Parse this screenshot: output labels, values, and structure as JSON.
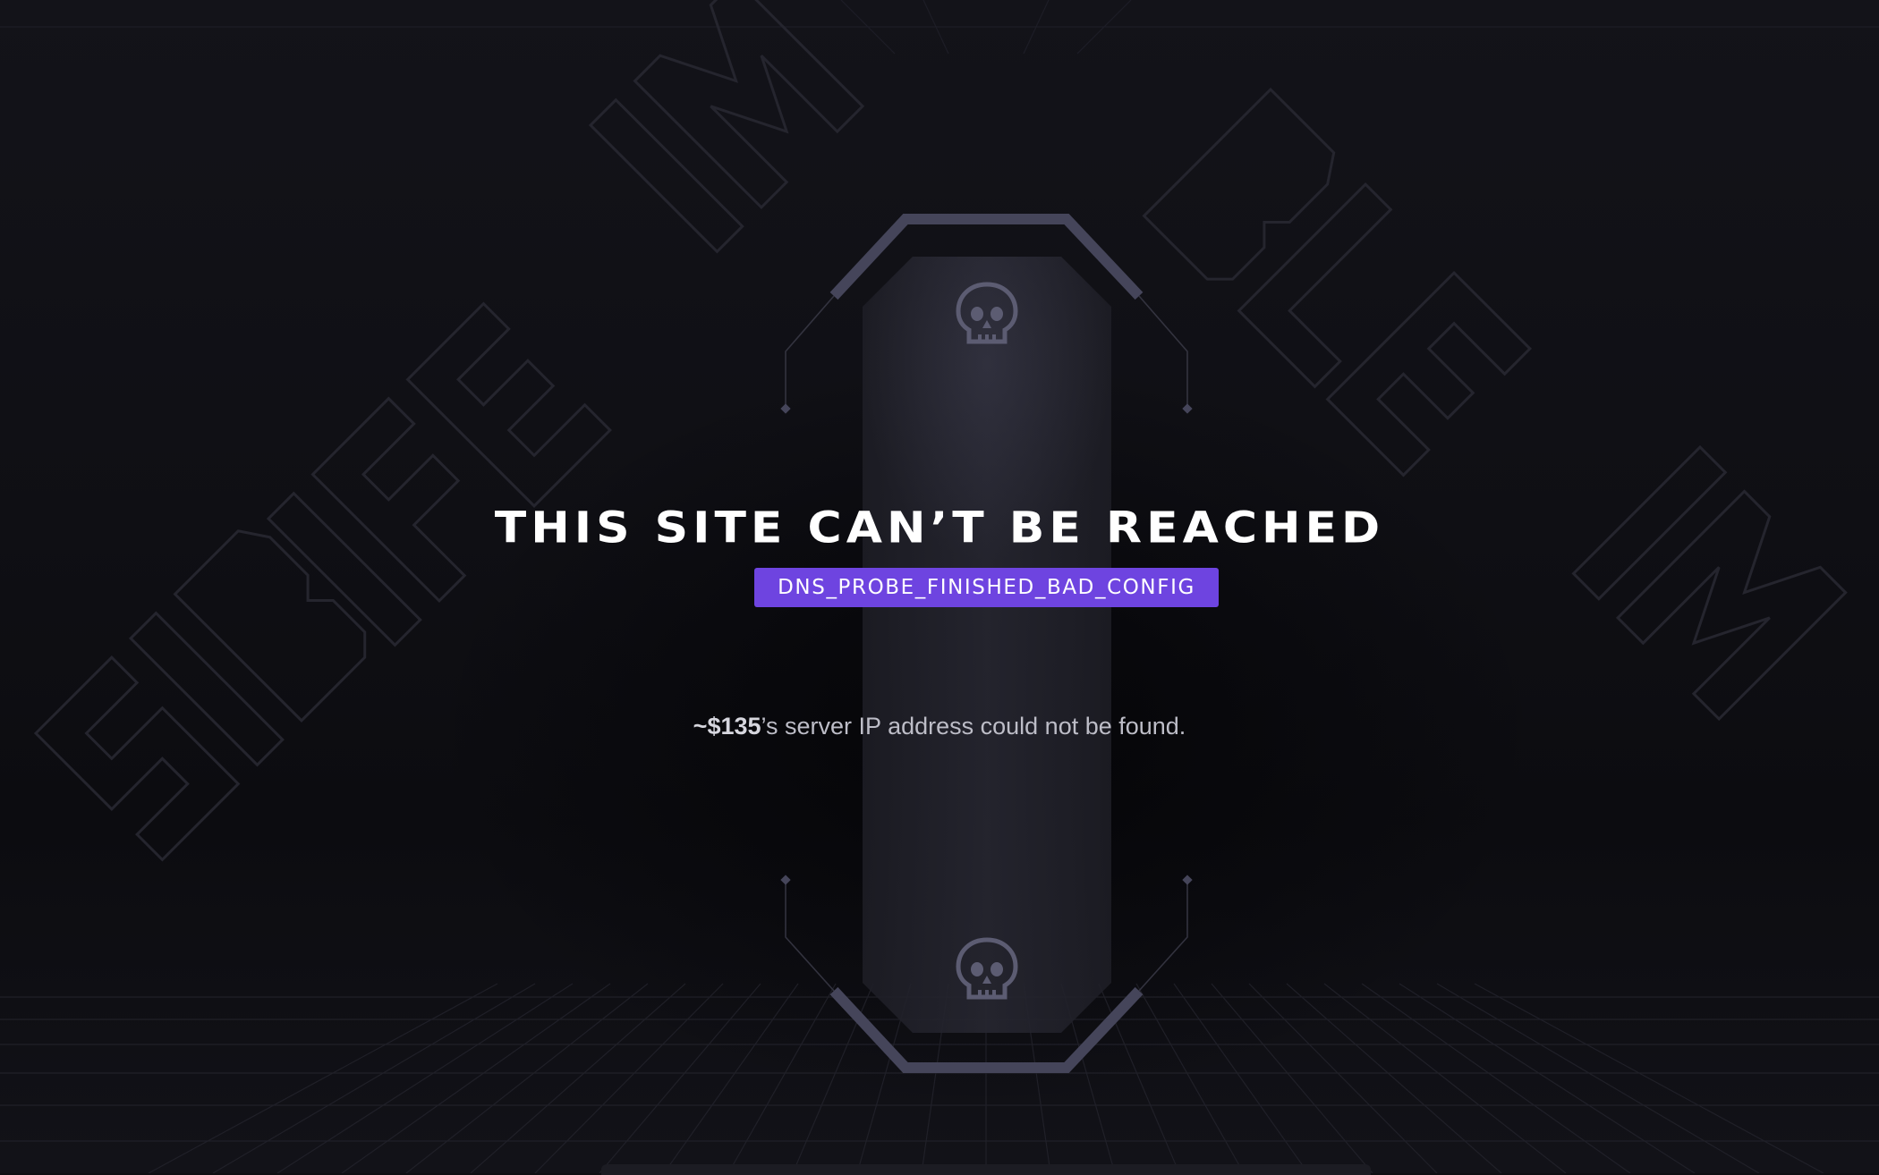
{
  "page": {
    "title": "THIS SITE CAN’T BE REACHED",
    "error_code": "DNS_PROBE_FINISHED_BAD_CONFIG",
    "host": "~$135",
    "message_suffix": "’s server IP address could not be found."
  },
  "background": {
    "watermark_text": "IMPOSSIBLE"
  },
  "icons": {
    "top": "skull-icon",
    "bottom": "skull-icon"
  },
  "colors": {
    "background": "#0e0e12",
    "accent": "#6e44e0",
    "frame": "#45455a",
    "skull": "#5c5c72",
    "title": "#ffffff",
    "message": "#bdbdc7"
  }
}
